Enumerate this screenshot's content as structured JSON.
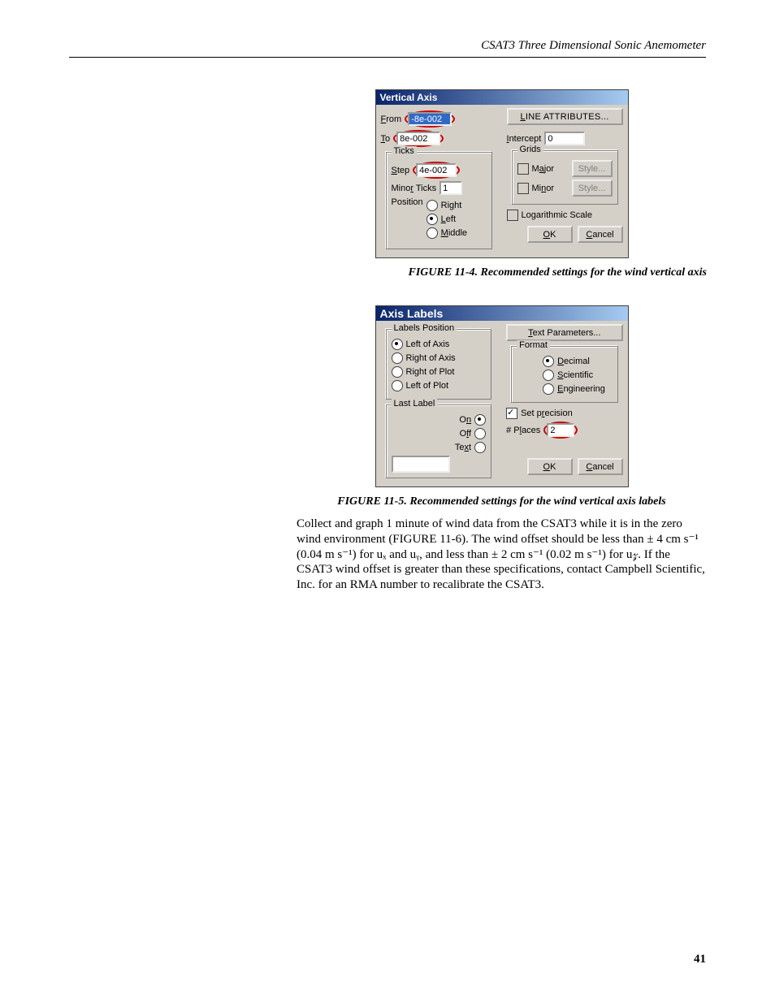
{
  "header": {
    "running_title": "CSAT3 Three Dimensional Sonic Anemometer"
  },
  "page_number": "41",
  "fig4": {
    "caption": "FIGURE 11-4.  Recommended settings for the wind vertical axis",
    "title": "Vertical Axis",
    "from_lbl": "From",
    "from_val": "-8e-002",
    "to_lbl": "To",
    "to_val": "8e-002",
    "line_attr_btn": "LINE ATTRIBUTES...",
    "intercept_lbl": "Intercept",
    "intercept_val": "0",
    "ticks_legend": "Ticks",
    "step_lbl": "Step",
    "step_val": "4e-002",
    "minor_lbl": "Minor Ticks",
    "minor_val": "1",
    "pos_lbl": "Position",
    "pos_right": "Right",
    "pos_left": "Left",
    "pos_mid": "Middle",
    "grids_legend": "Grids",
    "major_lbl": "Major",
    "minorg_lbl": "Minor",
    "style_btn": "Style...",
    "log_lbl": "Logarithmic Scale",
    "ok_btn": "OK",
    "cancel_btn": "Cancel"
  },
  "fig5": {
    "caption": "FIGURE 11-5.  Recommended settings for the wind vertical axis labels",
    "title": "Axis Labels",
    "labels_pos_legend": "Labels Position",
    "lp_left_axis": "Left of Axis",
    "lp_right_axis": "Right of Axis",
    "lp_right_plot": "Right of Plot",
    "lp_left_plot": "Left of Plot",
    "text_param_btn": "Text Parameters...",
    "format_legend": "Format",
    "fmt_decimal": "Decimal",
    "fmt_sci": "Scientific",
    "fmt_eng": "Engineering",
    "last_label_legend": "Last Label",
    "ll_on": "On",
    "ll_off": "Off",
    "ll_text": "Text",
    "set_prec_lbl": "Set precision",
    "places_lbl": "# Places",
    "places_val": "2",
    "ok_btn": "OK",
    "cancel_btn": "Cancel"
  },
  "paragraph": "Collect and graph 1 minute of wind data from the CSAT3 while it is in the zero wind environment (FIGURE 11-6). The wind offset should be less than ± 4 cm s⁻¹ (0.04 m s⁻¹) for uₓ and uᵧ, and less than ± 2 cm s⁻¹ (0.02 m s⁻¹) for u𝓏. If the CSAT3 wind offset is greater than these specifications, contact Campbell Scientific, Inc. for an RMA number to recalibrate the CSAT3."
}
